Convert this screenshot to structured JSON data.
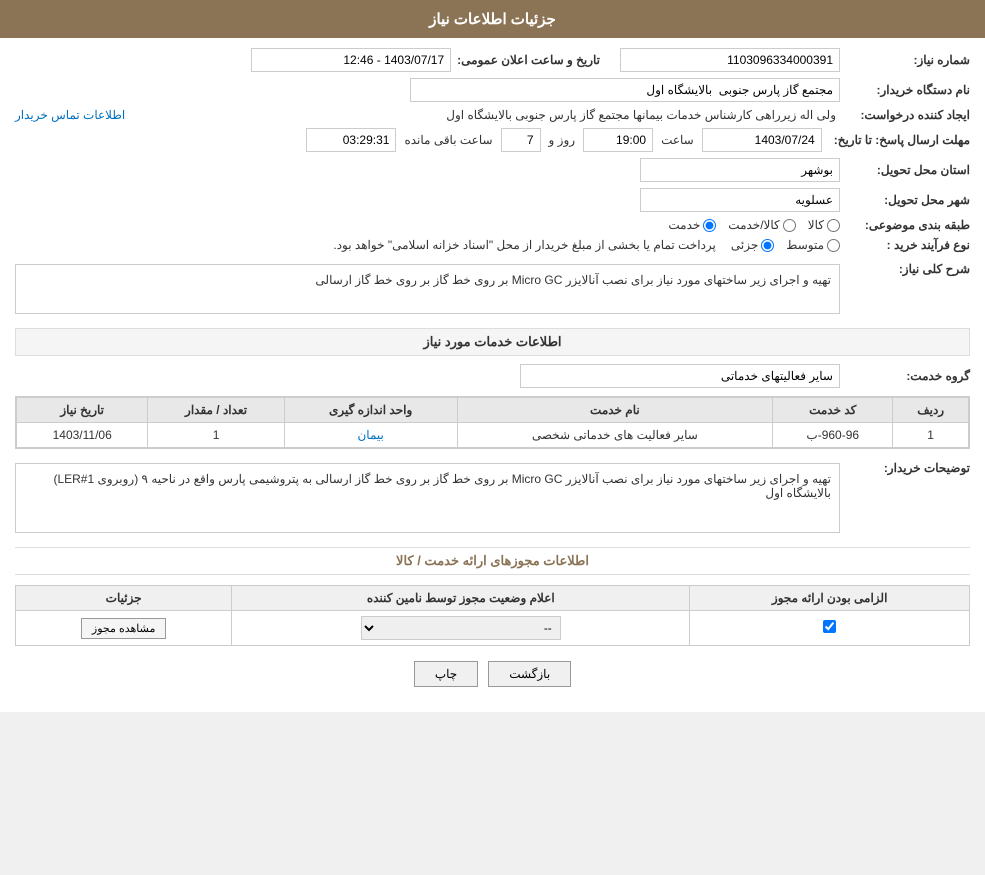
{
  "header": {
    "title": "جزئیات اطلاعات نیاز"
  },
  "fields": {
    "شماره_نیاز_label": "شماره نیاز:",
    "شماره_نیاز_value": "1103096334000391",
    "تاریخ_label": "تاریخ و ساعت اعلان عمومی:",
    "تاریخ_value": "1403/07/17 - 12:46",
    "نام_دستگاه_label": "نام دستگاه خریدار:",
    "نام_دستگاه_value": "مجتمع گاز پارس جنوبی  بالایشگاه اول",
    "ایجاد_کننده_label": "ایجاد کننده درخواست:",
    "ایجاد_کننده_value": "ولی اله زیرراهی کارشناس خدمات بیمانها مجتمع گاز پارس جنوبی  بالایشگاه اول",
    "اطلاعات_تماس": "اطلاعات تماس خریدار",
    "مهلت_label": "مهلت ارسال پاسخ: تا تاریخ:",
    "تاریخ_مهلت": "1403/07/24",
    "ساعت_label": "ساعت",
    "ساعت_value": "19:00",
    "روز_label": "روز و",
    "روز_value": "7",
    "باقیمانده_label": "ساعت باقی مانده",
    "باقیمانده_value": "03:29:31",
    "استان_label": "استان محل تحویل:",
    "استان_value": "بوشهر",
    "شهر_label": "شهر محل تحویل:",
    "شهر_value": "عسلویه",
    "طبقه_بندی_label": "طبقه بندی موضوعی:",
    "radio_خدمت": "خدمت",
    "radio_کالا_خدمت": "کالا/خدمت",
    "radio_کالا": "کالا",
    "نوع_فرایند_label": "نوع فرآیند خرید :",
    "radio_جزئی": "جزئی",
    "radio_متوسط": "متوسط",
    "نوع_فرایند_desc": "پرداخت تمام یا بخشی از مبلغ خریدار از محل \"اسناد خزانه اسلامی\" خواهد بود.",
    "شرح_label": "شرح کلی نیاز:",
    "شرح_value": "تهیه و اجرای زیر ساختهای مورد نیاز برای نصب آنالایزر Micro GC بر روی خط گاز بر روی خط گاز ارسالی",
    "اطلاعات_خدمات_title": "اطلاعات خدمات مورد نیاز",
    "گروه_خدمت_label": "گروه خدمت:",
    "گروه_خدمت_value": "سایر فعالیتهای خدماتی",
    "table": {
      "headers": [
        "ردیف",
        "کد خدمت",
        "نام خدمت",
        "واحد اندازه گیری",
        "تعداد / مقدار",
        "تاریخ نیاز"
      ],
      "rows": [
        {
          "ردیف": "1",
          "کد_خدمت": "960-96-ب",
          "نام_خدمت": "سایر فعالیت های خدماتی شخصی",
          "واحد": "بیمان",
          "تعداد": "1",
          "تاریخ_نیاز": "1403/11/06"
        }
      ]
    },
    "توضیحات_label": "توضیحات خریدار:",
    "توضیحات_value": "تهیه و اجرای زیر ساختهای مورد نیاز برای نصب آنالایزر Micro GC بر روی خط گاز بر روی خط گاز ارسالی به پتروشیمی پارس واقع در ناحیه ۹ (روبروی LER#1) بالایشگاه اول",
    "مجوزها_link": "اطلاعات مجوزهای ارائه خدمت / کالا",
    "permissions_table": {
      "headers": [
        "الزامی بودن ارائه مجوز",
        "اعلام وضعیت مجوز توسط نامین کننده",
        "جزئیات"
      ],
      "rows": [
        {
          "الزامی": true,
          "وضعیت": "--",
          "جزئیات_btn": "مشاهده مجوز"
        }
      ]
    }
  },
  "buttons": {
    "print": "چاپ",
    "back": "بازگشت"
  }
}
